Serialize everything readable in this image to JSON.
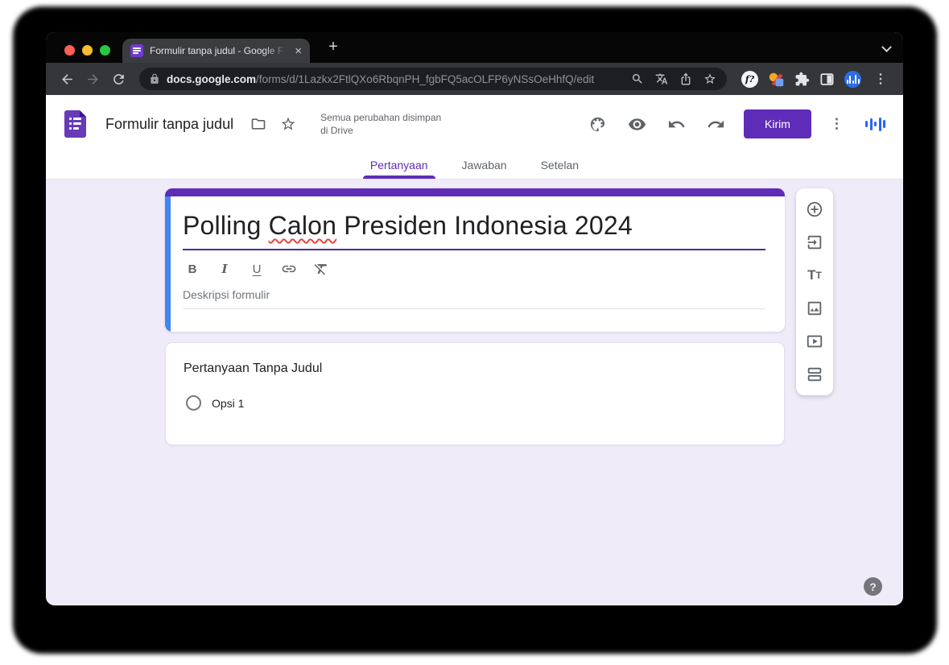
{
  "browser": {
    "tab_title": "Formulir tanpa judul - Google F",
    "url_domain": "docs.google.com",
    "url_path": "/forms/d/1Lazkx2FtlQXo6RbqnPH_fgbFQ5acOLFP6yNSsOeHhfQ/edit"
  },
  "glyphs": {
    "new_tab": "+",
    "close_tab": "×",
    "kebab": "⋮",
    "f_extension": "f?",
    "bold": "B",
    "italic": "I",
    "underline": "U",
    "tt_large": "T",
    "tt_small": "T",
    "help": "?"
  },
  "header": {
    "doc_title": "Formulir tanpa judul",
    "save_status_line1": "Semua perubahan disimpan",
    "save_status_line2": "di Drive",
    "send_label": "Kirim"
  },
  "nav_tabs": {
    "items": [
      {
        "label": "Pertanyaan",
        "active": true
      },
      {
        "label": "Jawaban",
        "active": false
      },
      {
        "label": "Setelan",
        "active": false
      }
    ]
  },
  "form": {
    "title_before": "Polling ",
    "title_misspelled": "Calon",
    "title_after": " Presiden Indonesia 2024",
    "description_placeholder": "Deskripsi formulir"
  },
  "question": {
    "title": "Pertanyaan Tanpa Judul",
    "options": [
      {
        "label": "Opsi 1"
      }
    ]
  },
  "colors": {
    "accent_purple": "#5e2cb8",
    "selected_card_blue": "#4285f4",
    "page_background": "#f0ebf8",
    "forms_logo_purple": "#673ab7"
  }
}
